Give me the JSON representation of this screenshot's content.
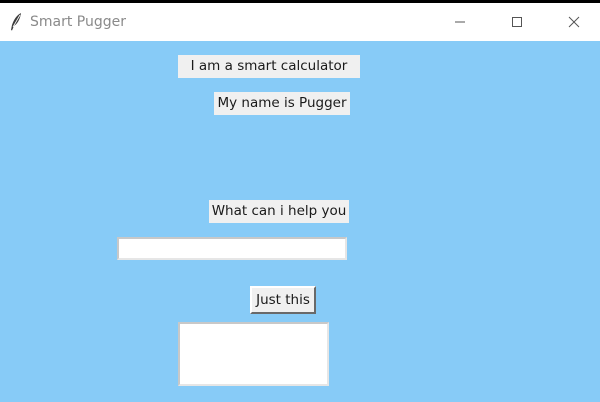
{
  "window": {
    "title": "Smart Pugger",
    "app_icon": "feather-icon",
    "controls": {
      "minimize_icon": "minimize-icon",
      "maximize_icon": "maximize-icon",
      "close_icon": "close-icon"
    }
  },
  "main": {
    "heading": "I am a smart calculator",
    "name_label": "My name is Pugger",
    "prompt_label": "What can i help you",
    "query_input": {
      "value": "",
      "placeholder": ""
    },
    "submit_button_label": "Just this",
    "output_box": {
      "value": ""
    }
  },
  "colors": {
    "client_background": "#87cbf7",
    "label_background": "#f0f0f0",
    "titlebar_background": "#ffffff",
    "title_text": "#8a8a8a"
  }
}
